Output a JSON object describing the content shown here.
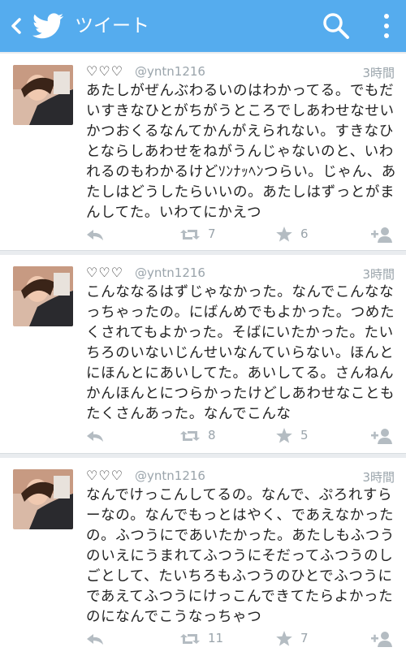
{
  "header": {
    "title": "ツイート"
  },
  "tweets": [
    {
      "hearts": "♡♡♡",
      "handle": "@yntn1216",
      "time": "3時間",
      "text": "あたしがぜんぶわるいのはわかってる。でもだいすきなひとがちがうところでしあわせなせいかつおくるなんてかんがえられない。すきなひとならしあわせをねがうんじゃないのと、いわれるのもわかるけどｿﾝﾅｯﾍﾝつらい。じゃん、あたしはどうしたらいいの。あたしはずっとがまんしてた。いわてにかえつ",
      "retweets": "7",
      "favorites": "6"
    },
    {
      "hearts": "♡♡♡",
      "handle": "@yntn1216",
      "time": "3時間",
      "text": "こんななるはずじゃなかった。なんでこんななっちゃったの。にばんめでもよかった。つめたくされてもよかった。そばにいたかった。たいちろのいないじんせいなんていらない。ほんとにほんとにあいしてた。あいしてる。さんねんかんほんとにつらかったけどしあわせなこともたくさんあった。なんでこんな",
      "retweets": "8",
      "favorites": "5"
    },
    {
      "hearts": "♡♡♡",
      "handle": "@yntn1216",
      "time": "3時間",
      "text": "なんでけっこんしてるの。なんで、ぷろれすらーなの。なんでもっとはやく、であえなかったの。ふつうにであいたかった。あたしもふつうのいえにうまれてふつうにそだってふつうのしごとして、たいちろもふつうのひとでふつうにであえてふつうにけっこんできてたらよかったのになんでこうなっちゃつ",
      "retweets": "11",
      "favorites": "7"
    }
  ],
  "colors": {
    "accent": "#55acee",
    "action_gray": "#b4bcc2"
  }
}
